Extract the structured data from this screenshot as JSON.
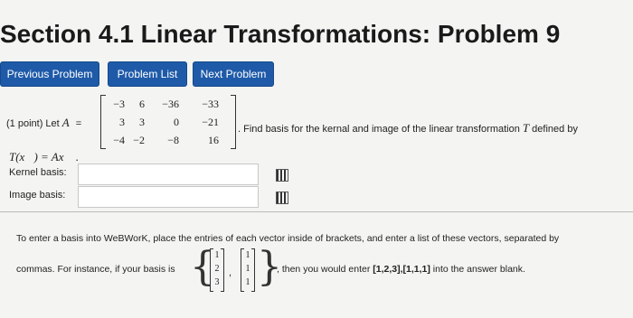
{
  "header": {
    "title": "Section 4.1 Linear Transformations: Problem 9"
  },
  "nav": {
    "previous": "Previous Problem",
    "list": "Problem List",
    "next": "Next Problem"
  },
  "problem": {
    "points_prefix": "(1 point) Let ",
    "A_symbol": "A",
    "equals": "=",
    "matrix": [
      [
        "−3",
        "6",
        "−36",
        "−33"
      ],
      [
        "3",
        "3",
        "0",
        "−21"
      ],
      [
        "−4",
        "−2",
        "−8",
        "16"
      ]
    ],
    "after_matrix": ". Find basis for the kernal and image of the linear transformation ",
    "T_symbol": "T",
    "defined_by": " defined by",
    "formula": "T(x⃗) = Ax⃗ ."
  },
  "answers": {
    "kernel_label": "Kernel basis:",
    "image_label": "Image basis:",
    "kernel_value": "",
    "image_value": ""
  },
  "help": {
    "line1": "To enter a basis into WeBWorK, place the entries of each vector inside of brackets, and enter a list of these vectors, separated by",
    "line2_prefix": "commas. For instance, if your basis is",
    "example_vectors": [
      [
        "1",
        "2",
        "3"
      ],
      [
        "1",
        "1",
        "1"
      ]
    ],
    "comma": ",",
    "line2_middle": ", then you would enter ",
    "example_entry": "[1,2,3],[1,1,1]",
    "line2_suffix": " into the answer blank."
  }
}
